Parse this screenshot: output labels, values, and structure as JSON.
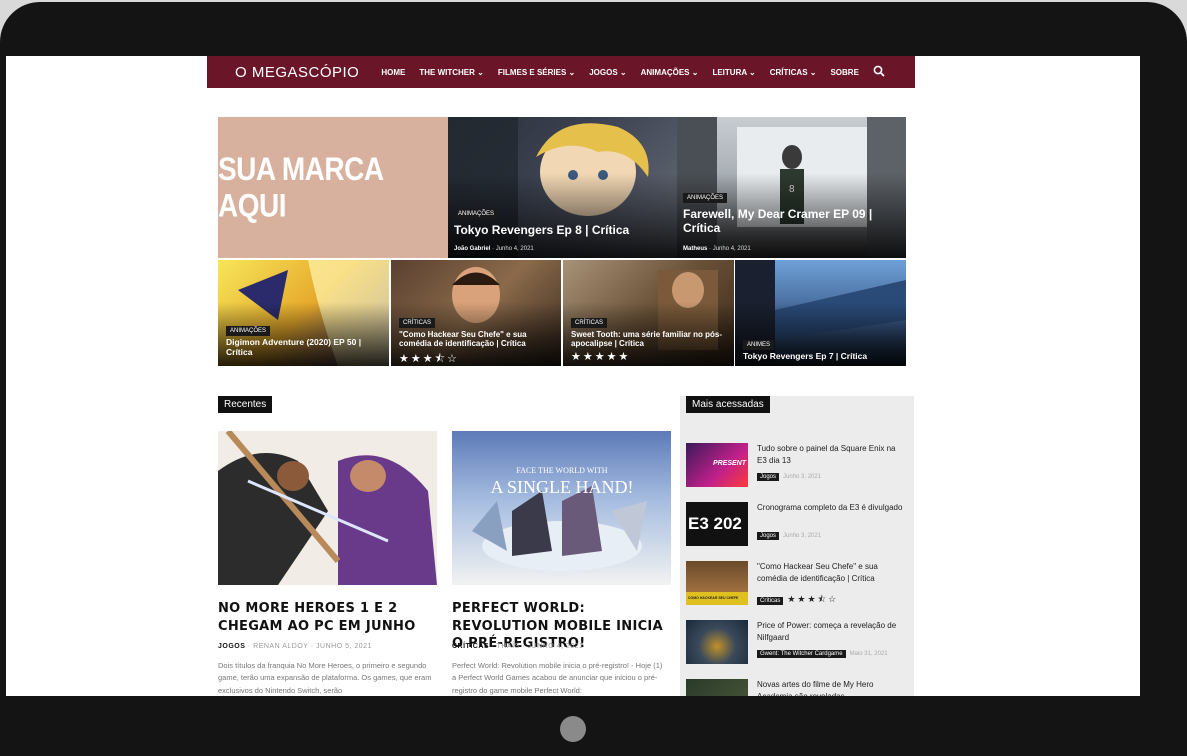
{
  "nav": {
    "logo": "O MEGASCÓPIO",
    "items": [
      "HOME",
      "THE WITCHER ⌄",
      "FILMES E SÉRIES ⌄",
      "JOGOS ⌄",
      "ANIMAÇÕES ⌄",
      "LEITURA ⌄",
      "CRÍTICAS ⌄",
      "SOBRE"
    ]
  },
  "brand": {
    "text": "SUA MARCA AQUI"
  },
  "hero": {
    "big": [
      {
        "tag": "Animações",
        "title": "Tokyo Revengers Ep 8 | Crítica",
        "author": "João Gabriel",
        "date": "Junho 4, 2021"
      },
      {
        "tag": "Animações",
        "title": "Farewell, My Dear Cramer EP 09 | Crítica",
        "author": "Matheus",
        "date": "Junho 4, 2021"
      }
    ],
    "small": [
      {
        "tag": "Animações",
        "title": "Digimon Adventure (2020) EP 50 | Crítica",
        "stars": ""
      },
      {
        "tag": "Críticas",
        "title": "\"Como Hackear Seu Chefe\" e sua comédia de identificação | Crítica",
        "stars": "★★★⯪☆"
      },
      {
        "tag": "Críticas",
        "title": "Sweet Tooth: uma série familiar no pós-apocalipse | Crítica",
        "stars": "★★★★★"
      },
      {
        "tag": "Animes",
        "title": "Tokyo Revengers Ep 7 | Crítica",
        "stars": ""
      }
    ]
  },
  "recentes": {
    "label": "Recentes",
    "posts": [
      {
        "title": "NO MORE HEROES 1 E 2 CHEGAM AO PC EM JUNHO",
        "category": "JOGOS",
        "author": "RENAN ALDOY",
        "date": "JUNHO 5, 2021",
        "excerpt": "Dois títulos da franquia No More Heroes, o primeiro e segundo game, terão uma expansão de plataforma. Os games, que eram exclusivos do Nintendo Switch, serão"
      },
      {
        "title": "PERFECT WORLD: REVOLUTION MOBILE INICIA O PRÉ-REGISTRO!",
        "category": "CRÍTICAS",
        "author": "THAÍS",
        "date": "JUNHO 4, 2021",
        "excerpt": "Perfect World: Revolution mobile inicia o pré-registro! - Hoje (1) a Perfect World Games acabou de anunciar que iniciou o pré-registro do game mobile Perfect World:"
      }
    ],
    "banner_text_1": "FACE THE WORLD WITH",
    "banner_text_2": "A SINGLE HAND!"
  },
  "mais": {
    "label": "Mais acessadas",
    "items": [
      {
        "title": "Tudo sobre o painel da Square Enix na E3 dia 13",
        "cat": "Jogos",
        "date": "Junho 3, 2021",
        "stars": "",
        "thumb_text": "PRESENT"
      },
      {
        "title": "Cronograma completo da E3 é divulgado",
        "cat": "Jogos",
        "date": "Junho 3, 2021",
        "stars": "",
        "thumb_text": "E3 202"
      },
      {
        "title": "\"Como Hackear Seu Chefe\" e sua comédia de identificação | Crítica",
        "cat": "Críticas",
        "date": "",
        "stars": "★★★⯪☆",
        "thumb_text": "COMO HACKEAR SEU CHEFE"
      },
      {
        "title": "Price of Power: começa a revelação de Nilfgaard",
        "cat": "Gwent: The Witcher Cardgame",
        "date": "Maio 31, 2021",
        "stars": "",
        "thumb_text": ""
      },
      {
        "title": "Novas artes do filme de My Hero Academia são reveladas",
        "cat": "",
        "date": "",
        "stars": "",
        "thumb_text": ""
      }
    ]
  },
  "colors": {
    "nav_bg": "#6b1628",
    "brand_bg": "#d8b09e",
    "bezel": "#141414"
  }
}
